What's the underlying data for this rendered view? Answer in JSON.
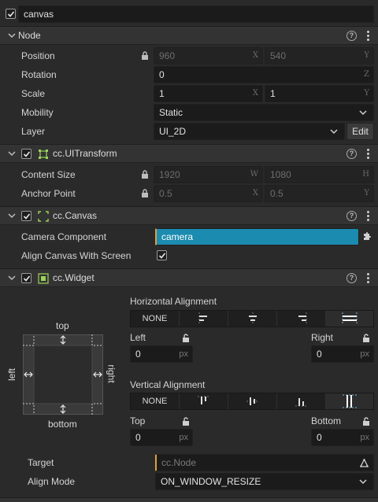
{
  "node": {
    "name": "canvas",
    "enabled": true
  },
  "sections": {
    "node": {
      "title": "Node"
    },
    "uitransform": {
      "title": "cc.UITransform"
    },
    "canvas": {
      "title": "cc.Canvas"
    },
    "widget": {
      "title": "cc.Widget"
    }
  },
  "node_props": {
    "position": {
      "label": "Position",
      "x": "960",
      "y": "540",
      "x_axis": "X",
      "y_axis": "Y"
    },
    "rotation": {
      "label": "Rotation",
      "z": "0",
      "z_axis": "Z"
    },
    "scale": {
      "label": "Scale",
      "x": "1",
      "y": "1",
      "x_axis": "X",
      "y_axis": "Y"
    },
    "mobility": {
      "label": "Mobility",
      "value": "Static"
    },
    "layer": {
      "label": "Layer",
      "value": "UI_2D",
      "edit_label": "Edit"
    }
  },
  "uitransform_props": {
    "content_size": {
      "label": "Content Size",
      "w": "1920",
      "h": "1080",
      "w_axis": "W",
      "h_axis": "H"
    },
    "anchor_point": {
      "label": "Anchor Point",
      "x": "0.5",
      "y": "0.5",
      "x_axis": "X",
      "y_axis": "Y"
    }
  },
  "canvas_props": {
    "camera_component": {
      "label": "Camera Component",
      "value": "camera"
    },
    "align_canvas": {
      "label": "Align Canvas With Screen",
      "checked": true
    }
  },
  "widget_props": {
    "diagram": {
      "top": "top",
      "bottom": "bottom",
      "left": "left",
      "right": "right"
    },
    "horizontal": {
      "label": "Horizontal Alignment",
      "none_label": "NONE"
    },
    "vertical": {
      "label": "Vertical Alignment",
      "none_label": "NONE"
    },
    "left": {
      "label": "Left",
      "value": "0",
      "unit": "px"
    },
    "right": {
      "label": "Right",
      "value": "0",
      "unit": "px"
    },
    "top": {
      "label": "Top",
      "value": "0",
      "unit": "px"
    },
    "bottom": {
      "label": "Bottom",
      "value": "0",
      "unit": "px"
    },
    "target": {
      "label": "Target",
      "placeholder": "cc.Node"
    },
    "align_mode": {
      "label": "Align Mode",
      "value": "ON_WINDOW_RESIZE"
    }
  },
  "colors": {
    "accent": "#1f7fa0",
    "selected_field": "#1b8bb0"
  }
}
